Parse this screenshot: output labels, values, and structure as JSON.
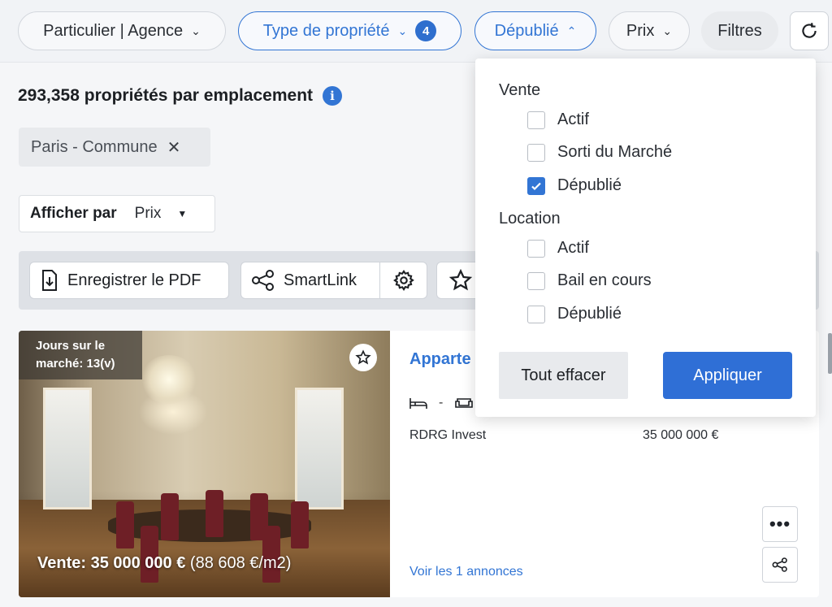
{
  "filters": {
    "seller_type": "Particulier | Agence",
    "property_type": "Type de propriété",
    "property_type_count": "4",
    "status": "Dépublié",
    "price": "Prix",
    "more": "Filtres"
  },
  "results": {
    "count_title": "293,358 propriétés par emplacement",
    "location_chip": "Paris - Commune",
    "sort_label": "Afficher par",
    "sort_value": "Prix"
  },
  "toolbar": {
    "pdf_label": "Enregistrer le PDF",
    "smartlink_label": "SmartLink"
  },
  "listing": {
    "days_on_market": "Jours sur le marché: 13(v)",
    "price_bold": "Vente: 35 000 000 €",
    "price_per_m2": "(88 608 €/m2)",
    "title": "Apparte",
    "beds": "-",
    "agent": "RDRG Invest",
    "price": "35 000 000 €",
    "see_ads": "Voir les 1 annonces"
  },
  "status_dropdown": {
    "sale_group": "Vente",
    "sale_options": [
      {
        "label": "Actif",
        "checked": false
      },
      {
        "label": "Sorti du Marché",
        "checked": false
      },
      {
        "label": "Dépublié",
        "checked": true
      }
    ],
    "rent_group": "Location",
    "rent_options": [
      {
        "label": "Actif",
        "checked": false
      },
      {
        "label": "Bail en cours",
        "checked": false
      },
      {
        "label": "Dépublié",
        "checked": false
      }
    ],
    "clear_label": "Tout effacer",
    "apply_label": "Appliquer"
  },
  "colors": {
    "accent": "#3275d4",
    "apply_bg": "#2f6fd6"
  }
}
